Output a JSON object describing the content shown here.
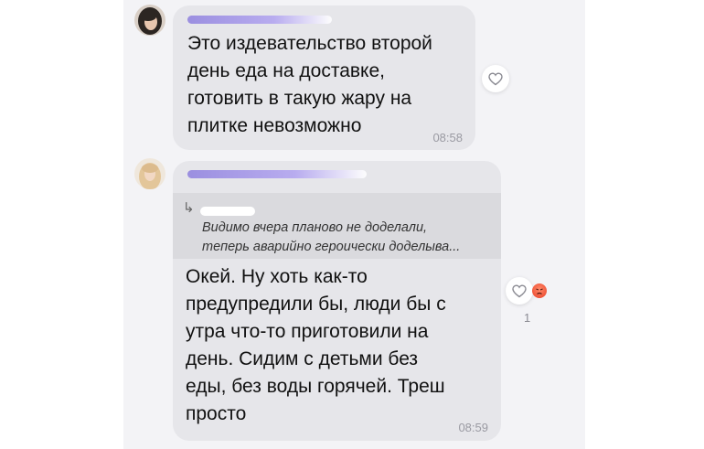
{
  "messages": [
    {
      "text_lines": [
        "Это издевательство второй",
        "день еда на доставке,",
        "готовить в такую жару на",
        "плитке невозможно"
      ],
      "time": "08:58"
    },
    {
      "reply": {
        "quote_lines": [
          "Видимо вчера планово не доделали,",
          "теперь аварийно героически доделыва..."
        ]
      },
      "text_lines": [
        "Окей. Ну хоть как-то",
        "предупредили бы, люди бы с",
        "утра что-то приготовили на",
        "день. Сидим с детьми без",
        "еды, без воды горячей. Треш",
        "просто"
      ],
      "time": "08:59",
      "reaction_count": "1"
    }
  ],
  "icons": {
    "like": "heart-outline-icon",
    "reply": "reply-arrow-icon",
    "reaction": "angry-emoji-icon"
  },
  "colors": {
    "bubble": "#e6e6ea",
    "chat_background": "#f3f3f6",
    "sender_name": "#9b8fe0"
  }
}
